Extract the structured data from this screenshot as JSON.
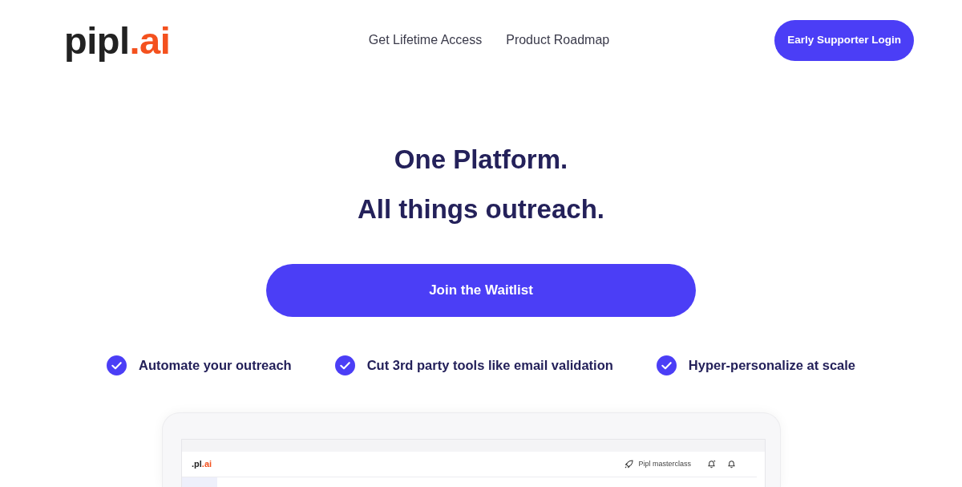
{
  "header": {
    "logo": {
      "name": "pipl",
      "accent": ".ai"
    },
    "nav_links": [
      "Get Lifetime Access",
      "Product Roadmap"
    ],
    "login_button": "Early Supporter Login"
  },
  "hero": {
    "headline_lines": [
      "One Platform.",
      "All things outreach."
    ],
    "cta_button": "Join the Waitlist",
    "features": [
      "Automate your outreach",
      "Cut 3rd party tools like email validation",
      "Hyper-personalize at scale"
    ]
  },
  "app_preview": {
    "logo": {
      "name": ".pl",
      "accent": ".ai"
    },
    "masterclass_link": "Pipl masterclass"
  }
}
